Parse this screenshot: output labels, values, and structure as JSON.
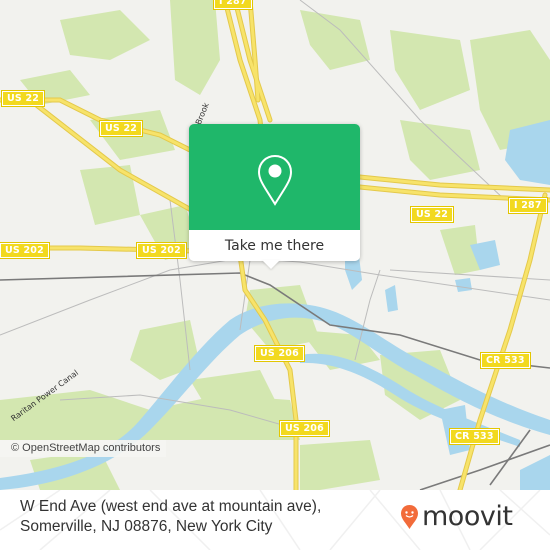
{
  "map": {
    "colors": {
      "land": "#f2f2ee",
      "park": "#cfe5a8",
      "water": "#a7d6ee",
      "highway": "#f7e36a",
      "highway_edge": "#e6c94a",
      "rail": "#808080",
      "minor_road": "#bdbdbd"
    },
    "shields": [
      {
        "id": "i287-top",
        "label": "I 287"
      },
      {
        "id": "us22-a",
        "label": "US 22"
      },
      {
        "id": "us22-b",
        "label": "US 22"
      },
      {
        "id": "us22-c",
        "label": "US 22"
      },
      {
        "id": "i287-right",
        "label": "I 287"
      },
      {
        "id": "us202-a",
        "label": "US 202"
      },
      {
        "id": "us202-b",
        "label": "US 202"
      },
      {
        "id": "us206-a",
        "label": "US 206"
      },
      {
        "id": "us206-b",
        "label": "US 206"
      },
      {
        "id": "cr533-a",
        "label": "CR 533"
      },
      {
        "id": "cr533-b",
        "label": "CR 533"
      }
    ],
    "street_labels": {
      "brook": "Brook",
      "canal": "Raritan Power Canal"
    },
    "attribution": "© OpenStreetMap contributors"
  },
  "popup": {
    "icon": "location-pin-icon",
    "button_label": "Take me there",
    "accent": "#1fb76a"
  },
  "footer": {
    "address_line1": "W End Ave (west end ave at mountain ave),",
    "address_line2": "Somerville, NJ 08876, New York City",
    "logo_text": "moovit",
    "logo_accent": "#f26b3a"
  }
}
